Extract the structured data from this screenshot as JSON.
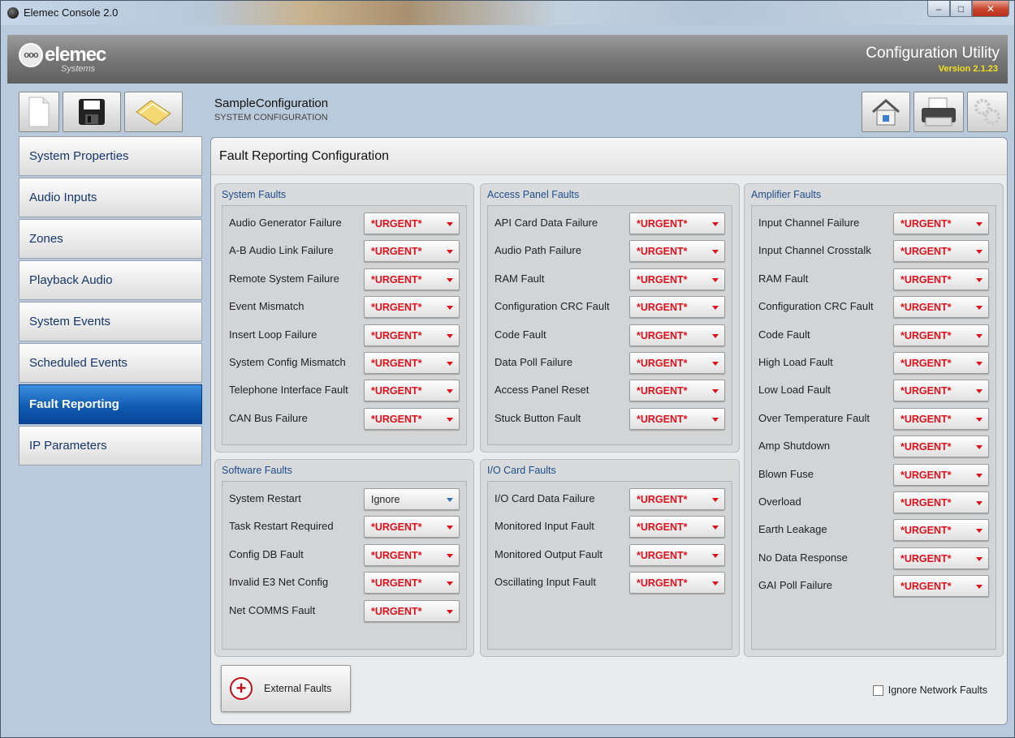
{
  "window": {
    "title": "Elemec Console 2.0"
  },
  "header": {
    "logo_text": "elemec",
    "logo_sub": "Systems",
    "app_title": "Configuration Utility",
    "version": "Version 2.1.23"
  },
  "toolbar": {
    "left": [
      "new-document-icon",
      "save-icon",
      "open-folder-icon"
    ],
    "right": [
      "home-icon",
      "printer-icon",
      "settings-gears-icon"
    ],
    "config_name": "SampleConfiguration",
    "config_sub": "SYSTEM CONFIGURATION"
  },
  "sidebar": {
    "items": [
      {
        "label": "System Properties"
      },
      {
        "label": "Audio Inputs"
      },
      {
        "label": "Zones"
      },
      {
        "label": "Playback Audio"
      },
      {
        "label": "System Events"
      },
      {
        "label": "Scheduled Events"
      },
      {
        "label": "Fault Reporting",
        "active": true
      },
      {
        "label": "IP Parameters"
      }
    ]
  },
  "main": {
    "title": "Fault Reporting Configuration",
    "groups": {
      "system_faults": {
        "title": "System Faults",
        "rows": [
          {
            "label": "Audio Generator Failure",
            "value": "*URGENT*"
          },
          {
            "label": "A-B Audio Link Failure",
            "value": "*URGENT*"
          },
          {
            "label": "Remote System Failure",
            "value": "*URGENT*"
          },
          {
            "label": "Event Mismatch",
            "value": "*URGENT*"
          },
          {
            "label": "Insert Loop Failure",
            "value": "*URGENT*"
          },
          {
            "label": "System Config Mismatch",
            "value": "*URGENT*"
          },
          {
            "label": "Telephone Interface Fault",
            "value": "*URGENT*"
          },
          {
            "label": "CAN Bus Failure",
            "value": "*URGENT*"
          }
        ]
      },
      "access_panel_faults": {
        "title": "Access Panel Faults",
        "rows": [
          {
            "label": "API Card Data Failure",
            "value": "*URGENT*"
          },
          {
            "label": "Audio Path Failure",
            "value": "*URGENT*"
          },
          {
            "label": "RAM Fault",
            "value": "*URGENT*"
          },
          {
            "label": "Configuration CRC Fault",
            "value": "*URGENT*"
          },
          {
            "label": "Code Fault",
            "value": "*URGENT*"
          },
          {
            "label": "Data Poll Failure",
            "value": "*URGENT*"
          },
          {
            "label": "Access Panel Reset",
            "value": "*URGENT*"
          },
          {
            "label": "Stuck Button Fault",
            "value": "*URGENT*"
          }
        ]
      },
      "amplifier_faults": {
        "title": "Amplifier Faults",
        "rows": [
          {
            "label": "Input Channel Failure",
            "value": "*URGENT*"
          },
          {
            "label": "Input Channel Crosstalk",
            "value": "*URGENT*"
          },
          {
            "label": "RAM Fault",
            "value": "*URGENT*"
          },
          {
            "label": "Configuration CRC Fault",
            "value": "*URGENT*"
          },
          {
            "label": "Code Fault",
            "value": "*URGENT*"
          },
          {
            "label": "High Load Fault",
            "value": "*URGENT*"
          },
          {
            "label": "Low Load Fault",
            "value": "*URGENT*"
          },
          {
            "label": "Over Temperature Fault",
            "value": "*URGENT*"
          },
          {
            "label": "Amp Shutdown",
            "value": "*URGENT*"
          },
          {
            "label": "Blown Fuse",
            "value": "*URGENT*"
          },
          {
            "label": "Overload",
            "value": "*URGENT*"
          },
          {
            "label": "Earth Leakage",
            "value": "*URGENT*"
          },
          {
            "label": "No Data Response",
            "value": "*URGENT*"
          },
          {
            "label": "GAI Poll Failure",
            "value": "*URGENT*"
          }
        ]
      },
      "software_faults": {
        "title": "Software Faults",
        "rows": [
          {
            "label": "System Restart",
            "value": "Ignore"
          },
          {
            "label": "Task Restart Required",
            "value": "*URGENT*"
          },
          {
            "label": "Config DB Fault",
            "value": "*URGENT*"
          },
          {
            "label": "Invalid E3 Net Config",
            "value": "*URGENT*"
          },
          {
            "label": "Net COMMS Fault",
            "value": "*URGENT*"
          }
        ]
      },
      "io_card_faults": {
        "title": "I/O Card Faults",
        "rows": [
          {
            "label": "I/O Card Data Failure",
            "value": "*URGENT*"
          },
          {
            "label": "Monitored Input Fault",
            "value": "*URGENT*"
          },
          {
            "label": "Monitored Output Fault",
            "value": "*URGENT*"
          },
          {
            "label": "Oscillating Input Fault",
            "value": "*URGENT*"
          }
        ]
      }
    },
    "external_faults_label": "External Faults",
    "ignore_network_faults_label": "Ignore Network Faults",
    "ignore_network_faults_checked": false
  },
  "colors": {
    "urgent": "#e0101b",
    "active_nav": "#0f58b0",
    "group_title": "#1c4d8b",
    "version": "#f2e020"
  }
}
